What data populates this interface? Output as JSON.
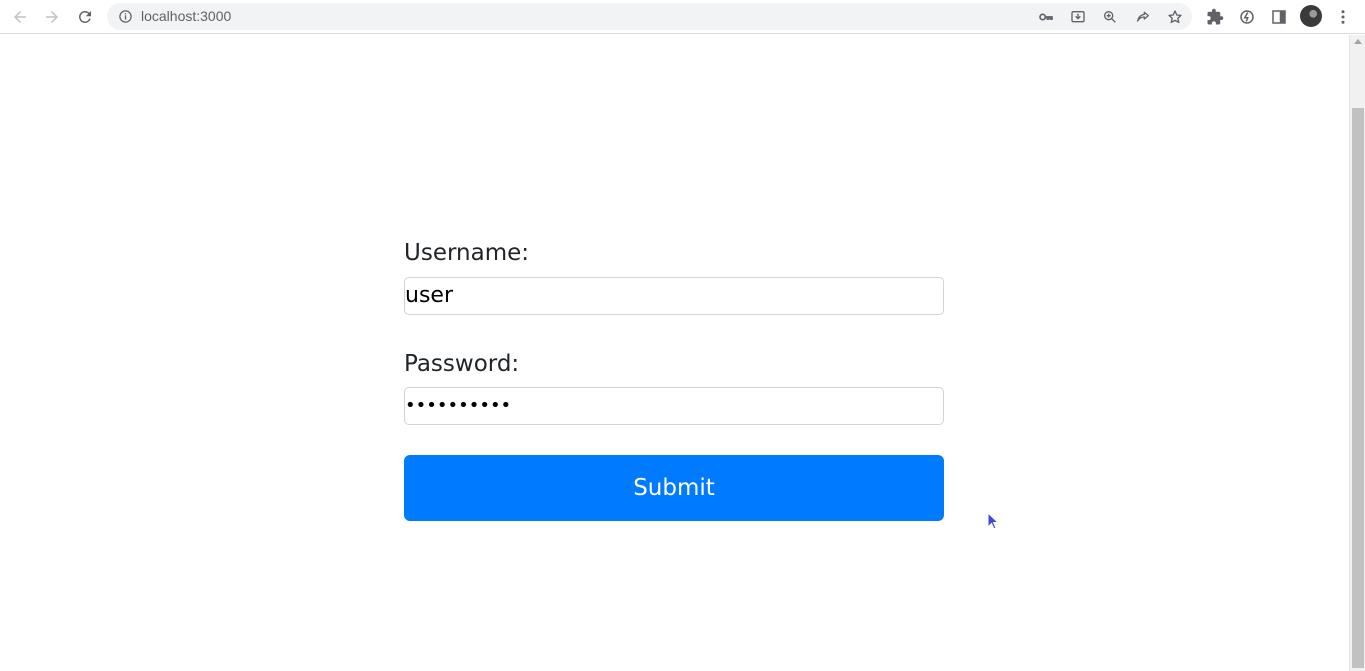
{
  "browser": {
    "url": "localhost:3000",
    "icons": {
      "back": "back-arrow-icon",
      "forward": "forward-arrow-icon",
      "reload": "reload-icon",
      "info": "info-icon",
      "key": "key-icon",
      "install": "install-app-icon",
      "zoom": "zoom-icon",
      "share": "share-icon",
      "bookmark": "star-icon",
      "extensions": "puzzle-icon",
      "extension2": "extension-icon",
      "sidepanel": "side-panel-icon",
      "menu": "kebab-menu-icon"
    }
  },
  "form": {
    "username_label": "Username:",
    "username_value": "user",
    "password_label": "Password:",
    "password_value": "••••••••••",
    "submit_label": "Submit"
  },
  "colors": {
    "accent": "#007bff",
    "text": "#212529",
    "input_border": "#ced4da"
  }
}
